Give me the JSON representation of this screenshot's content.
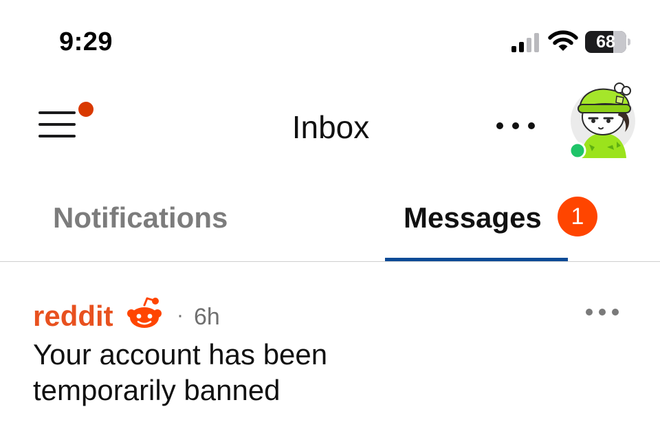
{
  "status_bar": {
    "time": "9:29",
    "battery_level": "68",
    "battery_fraction": 0.68,
    "icons": [
      "cellular-signal-icon",
      "wifi-icon",
      "battery-icon"
    ]
  },
  "header": {
    "title": "Inbox",
    "menu_icon": "hamburger-menu-icon",
    "more_icon": "more-horizontal-icon",
    "avatar_status": "online"
  },
  "tabs": [
    {
      "label": "Notifications",
      "selected": false
    },
    {
      "label": "Messages",
      "selected": true,
      "badge": "1"
    }
  ],
  "messages": [
    {
      "sender": "reddit",
      "sender_icon": "reddit-snoo-icon",
      "separator": "·",
      "time": "6h",
      "subject": "Your account has been temporarily banned"
    }
  ],
  "colors": {
    "brand_orange": "#ff4500",
    "sender_orange": "#e8511f",
    "online_green": "#1fc469",
    "tab_underline": "#0b4a96",
    "notification_dot": "#d93900"
  }
}
